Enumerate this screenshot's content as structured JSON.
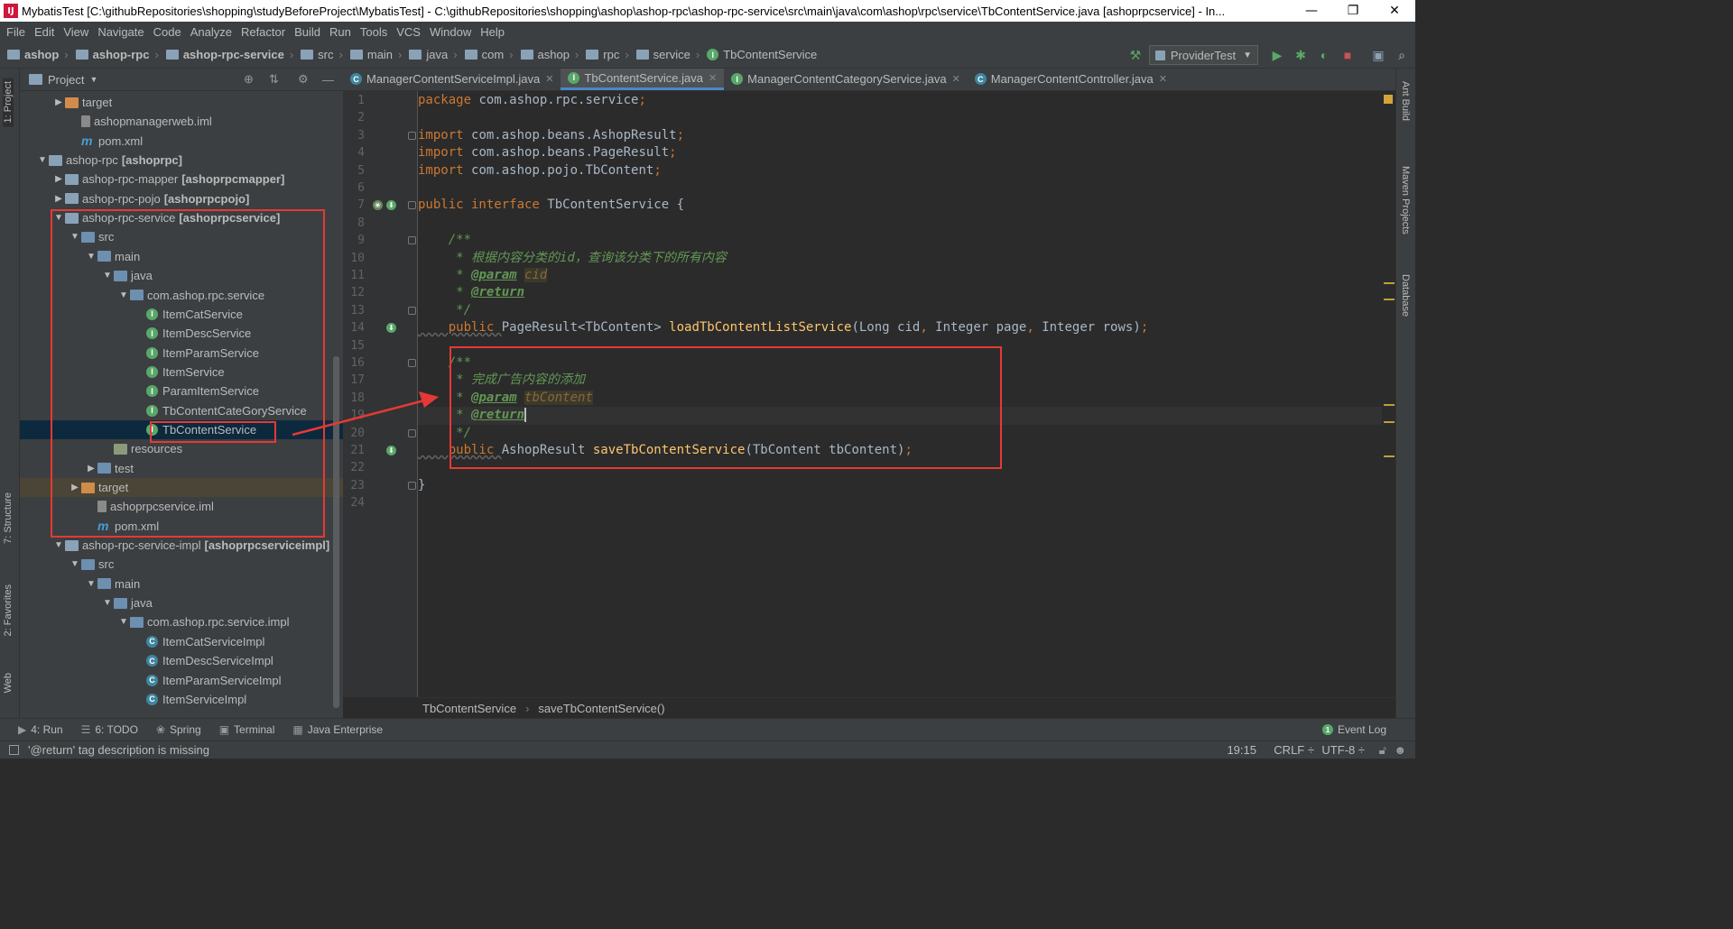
{
  "window": {
    "title": "MybatisTest [C:\\githubRepositories\\shopping\\studyBeforeProject\\MybatisTest] - C:\\githubRepositories\\shopping\\ashop\\ashop-rpc\\ashop-rpc-service\\src\\main\\java\\com\\ashop\\rpc\\service\\TbContentService.java [ashoprpcservice] - In...",
    "minimize": "—",
    "restore": "❐",
    "close": "✕"
  },
  "menu": [
    "File",
    "Edit",
    "View",
    "Navigate",
    "Code",
    "Analyze",
    "Refactor",
    "Build",
    "Run",
    "Tools",
    "VCS",
    "Window",
    "Help"
  ],
  "breadcrumbs": [
    "ashop",
    "ashop-rpc",
    "ashop-rpc-service",
    "src",
    "main",
    "java",
    "com",
    "ashop",
    "rpc",
    "service",
    "TbContentService"
  ],
  "run_config": "ProviderTest",
  "project_panel": {
    "title": "Project"
  },
  "tree": [
    {
      "indent": 2,
      "arrow": "▶",
      "icon": "target",
      "label": "target",
      "bold": ""
    },
    {
      "indent": 3,
      "arrow": "",
      "icon": "iml",
      "label": "ashopmanagerweb.iml",
      "bold": ""
    },
    {
      "indent": 3,
      "arrow": "",
      "icon": "m",
      "label": "pom.xml",
      "bold": ""
    },
    {
      "indent": 1,
      "arrow": "▼",
      "icon": "folder",
      "label": "ashop-rpc",
      "bold": "[ashoprpc]"
    },
    {
      "indent": 2,
      "arrow": "▶",
      "icon": "folder",
      "label": "ashop-rpc-mapper",
      "bold": "[ashoprpcmapper]"
    },
    {
      "indent": 2,
      "arrow": "▶",
      "icon": "folder",
      "label": "ashop-rpc-pojo",
      "bold": "[ashoprpcpojo]"
    },
    {
      "indent": 2,
      "arrow": "▼",
      "icon": "folder",
      "label": "ashop-rpc-service",
      "bold": "[ashoprpcservice]"
    },
    {
      "indent": 3,
      "arrow": "▼",
      "icon": "src",
      "label": "src",
      "bold": ""
    },
    {
      "indent": 4,
      "arrow": "▼",
      "icon": "src",
      "label": "main",
      "bold": ""
    },
    {
      "indent": 5,
      "arrow": "▼",
      "icon": "src",
      "label": "java",
      "bold": ""
    },
    {
      "indent": 6,
      "arrow": "▼",
      "icon": "src",
      "label": "com.ashop.rpc.service",
      "bold": ""
    },
    {
      "indent": 7,
      "arrow": "",
      "icon": "I",
      "label": "ItemCatService",
      "bold": ""
    },
    {
      "indent": 7,
      "arrow": "",
      "icon": "I",
      "label": "ItemDescService",
      "bold": ""
    },
    {
      "indent": 7,
      "arrow": "",
      "icon": "I",
      "label": "ItemParamService",
      "bold": ""
    },
    {
      "indent": 7,
      "arrow": "",
      "icon": "I",
      "label": "ItemService",
      "bold": ""
    },
    {
      "indent": 7,
      "arrow": "",
      "icon": "I",
      "label": "ParamItemService",
      "bold": ""
    },
    {
      "indent": 7,
      "arrow": "",
      "icon": "I",
      "label": "TbContentCateGoryService",
      "bold": ""
    },
    {
      "indent": 7,
      "arrow": "",
      "icon": "I",
      "label": "TbContentService",
      "bold": "",
      "selected": true
    },
    {
      "indent": 5,
      "arrow": "",
      "icon": "res",
      "label": "resources",
      "bold": ""
    },
    {
      "indent": 4,
      "arrow": "▶",
      "icon": "src",
      "label": "test",
      "bold": ""
    },
    {
      "indent": 3,
      "arrow": "▶",
      "icon": "target",
      "label": "target",
      "bold": "",
      "highlight": true
    },
    {
      "indent": 4,
      "arrow": "",
      "icon": "iml",
      "label": "ashoprpcservice.iml",
      "bold": ""
    },
    {
      "indent": 4,
      "arrow": "",
      "icon": "m",
      "label": "pom.xml",
      "bold": ""
    },
    {
      "indent": 2,
      "arrow": "▼",
      "icon": "folder",
      "label": "ashop-rpc-service-impl",
      "bold": "[ashoprpcserviceimpl]"
    },
    {
      "indent": 3,
      "arrow": "▼",
      "icon": "src",
      "label": "src",
      "bold": ""
    },
    {
      "indent": 4,
      "arrow": "▼",
      "icon": "src",
      "label": "main",
      "bold": ""
    },
    {
      "indent": 5,
      "arrow": "▼",
      "icon": "src",
      "label": "java",
      "bold": ""
    },
    {
      "indent": 6,
      "arrow": "▼",
      "icon": "src",
      "label": "com.ashop.rpc.service.impl",
      "bold": ""
    },
    {
      "indent": 7,
      "arrow": "",
      "icon": "C",
      "label": "ItemCatServiceImpl",
      "bold": ""
    },
    {
      "indent": 7,
      "arrow": "",
      "icon": "C",
      "label": "ItemDescServiceImpl",
      "bold": ""
    },
    {
      "indent": 7,
      "arrow": "",
      "icon": "C",
      "label": "ItemParamServiceImpl",
      "bold": ""
    },
    {
      "indent": 7,
      "arrow": "",
      "icon": "C",
      "label": "ItemServiceImpl",
      "bold": ""
    }
  ],
  "tabs": [
    {
      "label": "ManagerContentServiceImpl.java",
      "icon": "C",
      "active": false
    },
    {
      "label": "TbContentService.java",
      "icon": "I",
      "active": true
    },
    {
      "label": "ManagerContentCategoryService.java",
      "icon": "I",
      "active": false
    },
    {
      "label": "ManagerContentController.java",
      "icon": "C",
      "active": false
    }
  ],
  "code_lines": [
    [
      [
        "kw",
        "package "
      ],
      [
        "",
        "com.ashop.rpc.service"
      ],
      [
        "kw",
        ";"
      ]
    ],
    [],
    [
      [
        "kw",
        "import "
      ],
      [
        "",
        "com.ashop.beans.AshopResult"
      ],
      [
        "kw",
        ";"
      ]
    ],
    [
      [
        "kw",
        "import "
      ],
      [
        "",
        "com.ashop.beans.PageResult"
      ],
      [
        "kw",
        ";"
      ]
    ],
    [
      [
        "kw",
        "import "
      ],
      [
        "",
        "com.ashop.pojo.TbContent"
      ],
      [
        "kw",
        ";"
      ]
    ],
    [],
    [
      [
        "kw",
        "public interface "
      ],
      [
        "",
        "TbContentService {"
      ]
    ],
    [],
    [
      [
        "cm",
        "    /**"
      ]
    ],
    [
      [
        "cm",
        "     * 根据内容分类的id，查询该分类下的所有内容"
      ]
    ],
    [
      [
        "cm",
        "     * "
      ],
      [
        "tag",
        "@param"
      ],
      [
        "cm",
        " "
      ],
      [
        "pn",
        "cid"
      ]
    ],
    [
      [
        "cm",
        "     * "
      ],
      [
        "tag",
        "@return"
      ]
    ],
    [
      [
        "cm",
        "     */"
      ]
    ],
    [
      [
        "kwu",
        "    public "
      ],
      [
        "",
        "PageResult<TbContent> "
      ],
      [
        "fn",
        "loadTbContentListService"
      ],
      [
        "",
        "(Long cid"
      ],
      [
        "kw",
        ", "
      ],
      [
        "",
        "Integer page"
      ],
      [
        "kw",
        ", "
      ],
      [
        "",
        "Integer rows)"
      ],
      [
        "kw",
        ";"
      ]
    ],
    [],
    [
      [
        "cm",
        "    /**"
      ]
    ],
    [
      [
        "cm",
        "     * 完成广告内容的添加"
      ]
    ],
    [
      [
        "cm",
        "     * "
      ],
      [
        "tag",
        "@param"
      ],
      [
        "cm",
        " "
      ],
      [
        "pn",
        "tbContent"
      ]
    ],
    [
      [
        "cm",
        "     * "
      ],
      [
        "tag",
        "@return"
      ]
    ],
    [
      [
        "cm",
        "     */"
      ]
    ],
    [
      [
        "kwu",
        "    public "
      ],
      [
        "",
        "AshopResult "
      ],
      [
        "fn",
        "saveTbContentService"
      ],
      [
        "",
        "(TbContent tbContent)"
      ],
      [
        "kw",
        ";"
      ]
    ],
    [],
    [
      [
        "",
        "}"
      ]
    ],
    []
  ],
  "editor_breadcrumb": [
    "TbContentService",
    "saveTbContentService()"
  ],
  "left_tool_tabs": [
    "1: Project",
    "7: Structure",
    "2: Favorites",
    "Web"
  ],
  "right_tool_tabs": [
    "Ant Build",
    "Maven Projects",
    "Database"
  ],
  "tool_windows": [
    {
      "icon": "▶",
      "label": "4: Run"
    },
    {
      "icon": "☰",
      "label": "6: TODO"
    },
    {
      "icon": "❀",
      "label": "Spring"
    },
    {
      "icon": "▣",
      "label": "Terminal"
    },
    {
      "icon": "▦",
      "label": "Java Enterprise"
    }
  ],
  "event_log": "Event Log",
  "status": {
    "message": "'@return' tag description is missing",
    "position": "19:15",
    "line_sep": "CRLF ÷",
    "encoding": "UTF-8 ÷"
  },
  "colors": {
    "annotation_red": "#e53935",
    "selection": "#0d293e",
    "accent": "#4a88c7"
  }
}
